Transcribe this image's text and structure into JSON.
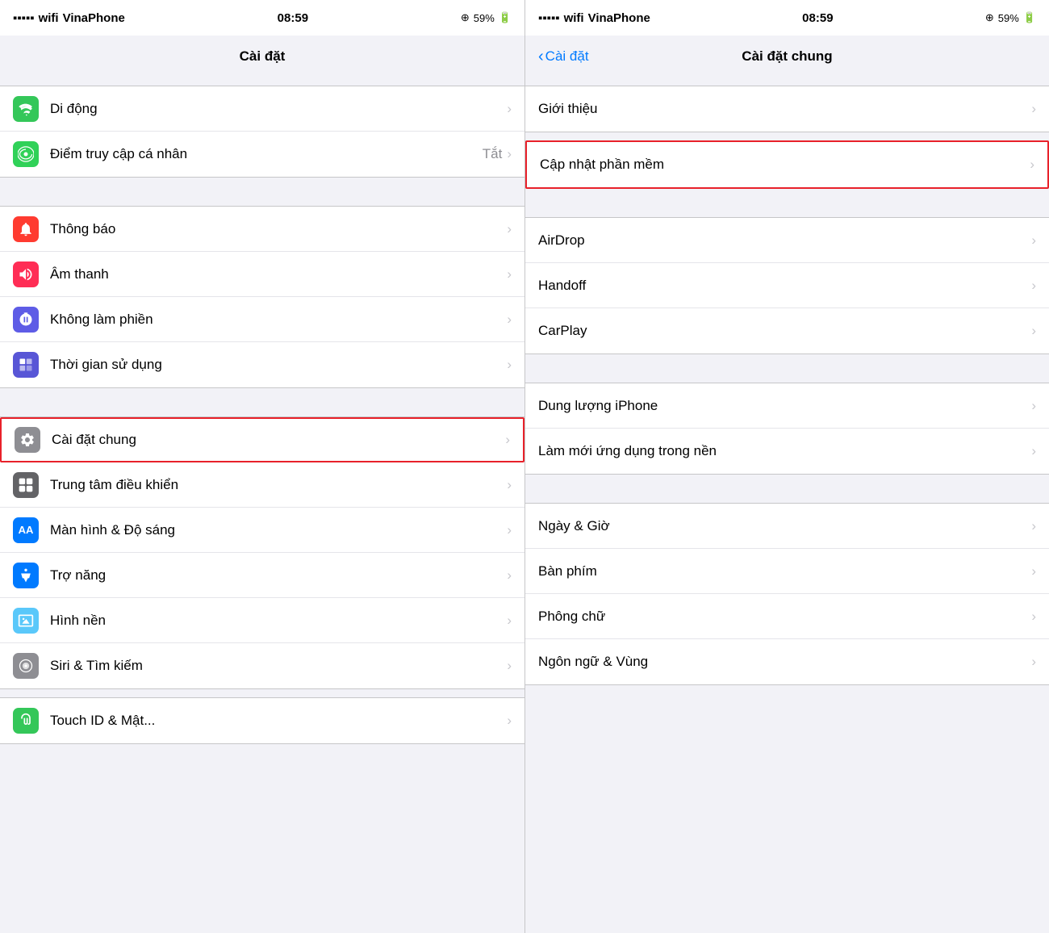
{
  "leftPanel": {
    "statusBar": {
      "carrier": "VinaPhone",
      "time": "08:59",
      "location": "⊕ 59%",
      "battery": "59%"
    },
    "navHeader": {
      "title": "Cài đặt"
    },
    "sections": [
      {
        "id": "section-mobile",
        "rows": [
          {
            "id": "di-dong",
            "label": "Di động",
            "iconBg": "icon-green",
            "icon": "📶",
            "iconUnicode": "▲"
          },
          {
            "id": "hotspot",
            "label": "Điểm truy cập cá nhân",
            "iconBg": "icon-green2",
            "icon": "🔗",
            "value": "Tắt"
          }
        ]
      },
      {
        "id": "section-notifications",
        "rows": [
          {
            "id": "thong-bao",
            "label": "Thông báo",
            "iconBg": "icon-red",
            "icon": "🔔"
          },
          {
            "id": "am-thanh",
            "label": "Âm thanh",
            "iconBg": "icon-pink",
            "icon": "🔊"
          },
          {
            "id": "khong-lam-phien",
            "label": "Không làm phiền",
            "iconBg": "icon-indigo",
            "icon": "🌙"
          },
          {
            "id": "thoi-gian",
            "label": "Thời gian sử dụng",
            "iconBg": "icon-purple",
            "icon": "⏳"
          }
        ]
      },
      {
        "id": "section-general",
        "highlight": true,
        "rows": [
          {
            "id": "cai-dat-chung",
            "label": "Cài đặt chung",
            "iconBg": "icon-gray",
            "icon": "⚙️",
            "highlight": true
          },
          {
            "id": "trung-tam",
            "label": "Trung tâm điều khiển",
            "iconBg": "icon-dark",
            "icon": "⊞"
          },
          {
            "id": "man-hinh",
            "label": "Màn hình & Độ sáng",
            "iconBg": "icon-blue",
            "icon": "AA"
          },
          {
            "id": "tro-nang",
            "label": "Trợ năng",
            "iconBg": "icon-blue",
            "icon": "♿"
          },
          {
            "id": "hinh-nen",
            "label": "Hình nền",
            "iconBg": "icon-teal",
            "icon": "✦"
          },
          {
            "id": "siri",
            "label": "Siri & Tìm kiếm",
            "iconBg": "icon-gray",
            "icon": "◎"
          }
        ]
      }
    ],
    "bottomRow": {
      "id": "touch-id",
      "label": "Touch ID & Mật...",
      "iconBg": "icon-green",
      "icon": "👆"
    }
  },
  "rightPanel": {
    "statusBar": {
      "carrier": "VinaPhone",
      "time": "08:59",
      "location": "⊕ 59%",
      "battery": "59%"
    },
    "navHeader": {
      "backLabel": "Cài đặt",
      "title": "Cài đặt chung"
    },
    "sections": [
      {
        "id": "section-about",
        "rows": [
          {
            "id": "gioi-thieu",
            "label": "Giới thiệu"
          }
        ]
      },
      {
        "id": "section-software",
        "highlight": true,
        "rows": [
          {
            "id": "cap-nhat",
            "label": "Cập nhật phần mềm",
            "highlight": true
          }
        ]
      },
      {
        "id": "section-connectivity",
        "rows": [
          {
            "id": "airdrop",
            "label": "AirDrop"
          },
          {
            "id": "handoff",
            "label": "Handoff"
          },
          {
            "id": "carplay",
            "label": "CarPlay"
          }
        ]
      },
      {
        "id": "section-storage",
        "rows": [
          {
            "id": "dung-luong",
            "label": "Dung lượng iPhone"
          },
          {
            "id": "lam-moi",
            "label": "Làm mới ứng dụng trong nền"
          }
        ]
      },
      {
        "id": "section-datetime",
        "rows": [
          {
            "id": "ngay-gio",
            "label": "Ngày & Giờ"
          },
          {
            "id": "ban-phim",
            "label": "Bàn phím"
          },
          {
            "id": "phong-chu",
            "label": "Phông chữ"
          },
          {
            "id": "ngon-ngu",
            "label": "Ngôn ngữ & Vùng"
          }
        ]
      }
    ]
  }
}
